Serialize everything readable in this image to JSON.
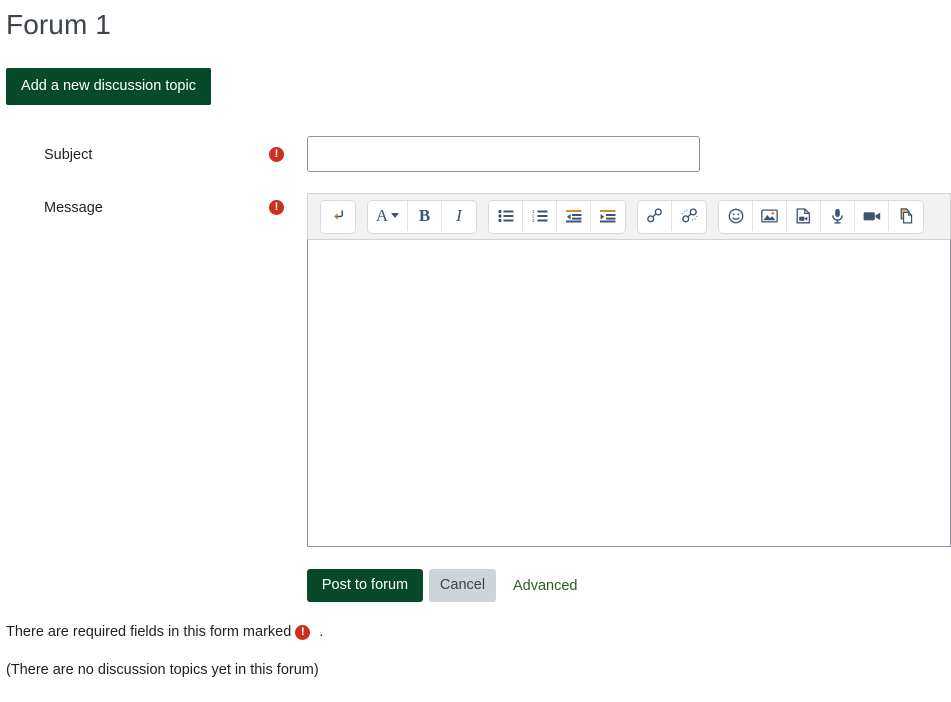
{
  "page": {
    "title": "Forum 1"
  },
  "actions": {
    "new_topic_label": "Add a new discussion topic"
  },
  "form": {
    "subject": {
      "label": "Subject",
      "value": "",
      "placeholder": "",
      "required_marker": "!"
    },
    "message": {
      "label": "Message",
      "value": "",
      "required_marker": "!"
    }
  },
  "editor": {
    "groups": [
      {
        "name": "paragraph-group",
        "buttons": [
          {
            "name": "line-break-icon",
            "title": "Insert line break"
          }
        ]
      },
      {
        "name": "style-group",
        "buttons": [
          {
            "name": "font-style-icon",
            "title": "Style",
            "text": "A"
          },
          {
            "name": "bold-icon",
            "title": "Bold",
            "text": "B"
          },
          {
            "name": "italic-icon",
            "title": "Italic",
            "text": "I"
          }
        ]
      },
      {
        "name": "list-group",
        "buttons": [
          {
            "name": "bullet-list-icon",
            "title": "Bulleted list"
          },
          {
            "name": "numbered-list-icon",
            "title": "Numbered list"
          },
          {
            "name": "outdent-icon",
            "title": "Decrease indent"
          },
          {
            "name": "indent-icon",
            "title": "Increase indent"
          }
        ]
      },
      {
        "name": "link-group",
        "buttons": [
          {
            "name": "link-icon",
            "title": "Link"
          },
          {
            "name": "unlink-icon",
            "title": "Unlink"
          }
        ]
      },
      {
        "name": "media-group",
        "buttons": [
          {
            "name": "emoji-icon",
            "title": "Emojis"
          },
          {
            "name": "image-icon",
            "title": "Image"
          },
          {
            "name": "media-file-icon",
            "title": "Multimedia"
          },
          {
            "name": "microphone-icon",
            "title": "Record audio"
          },
          {
            "name": "video-camera-icon",
            "title": "Record video"
          },
          {
            "name": "manage-files-icon",
            "title": "Manage files"
          }
        ]
      }
    ],
    "content": ""
  },
  "footer": {
    "post_label": "Post to forum",
    "cancel_label": "Cancel",
    "advanced_label": "Advanced",
    "required_note_before": "There are required fields in this form marked",
    "required_note_after": ".",
    "empty_note": "(There are no discussion topics yet in this forum)"
  },
  "colors": {
    "brand_green": "#064a2b",
    "required_red": "#ca3120",
    "cancel_gray": "#ced4da",
    "link_green": "#33562b"
  }
}
